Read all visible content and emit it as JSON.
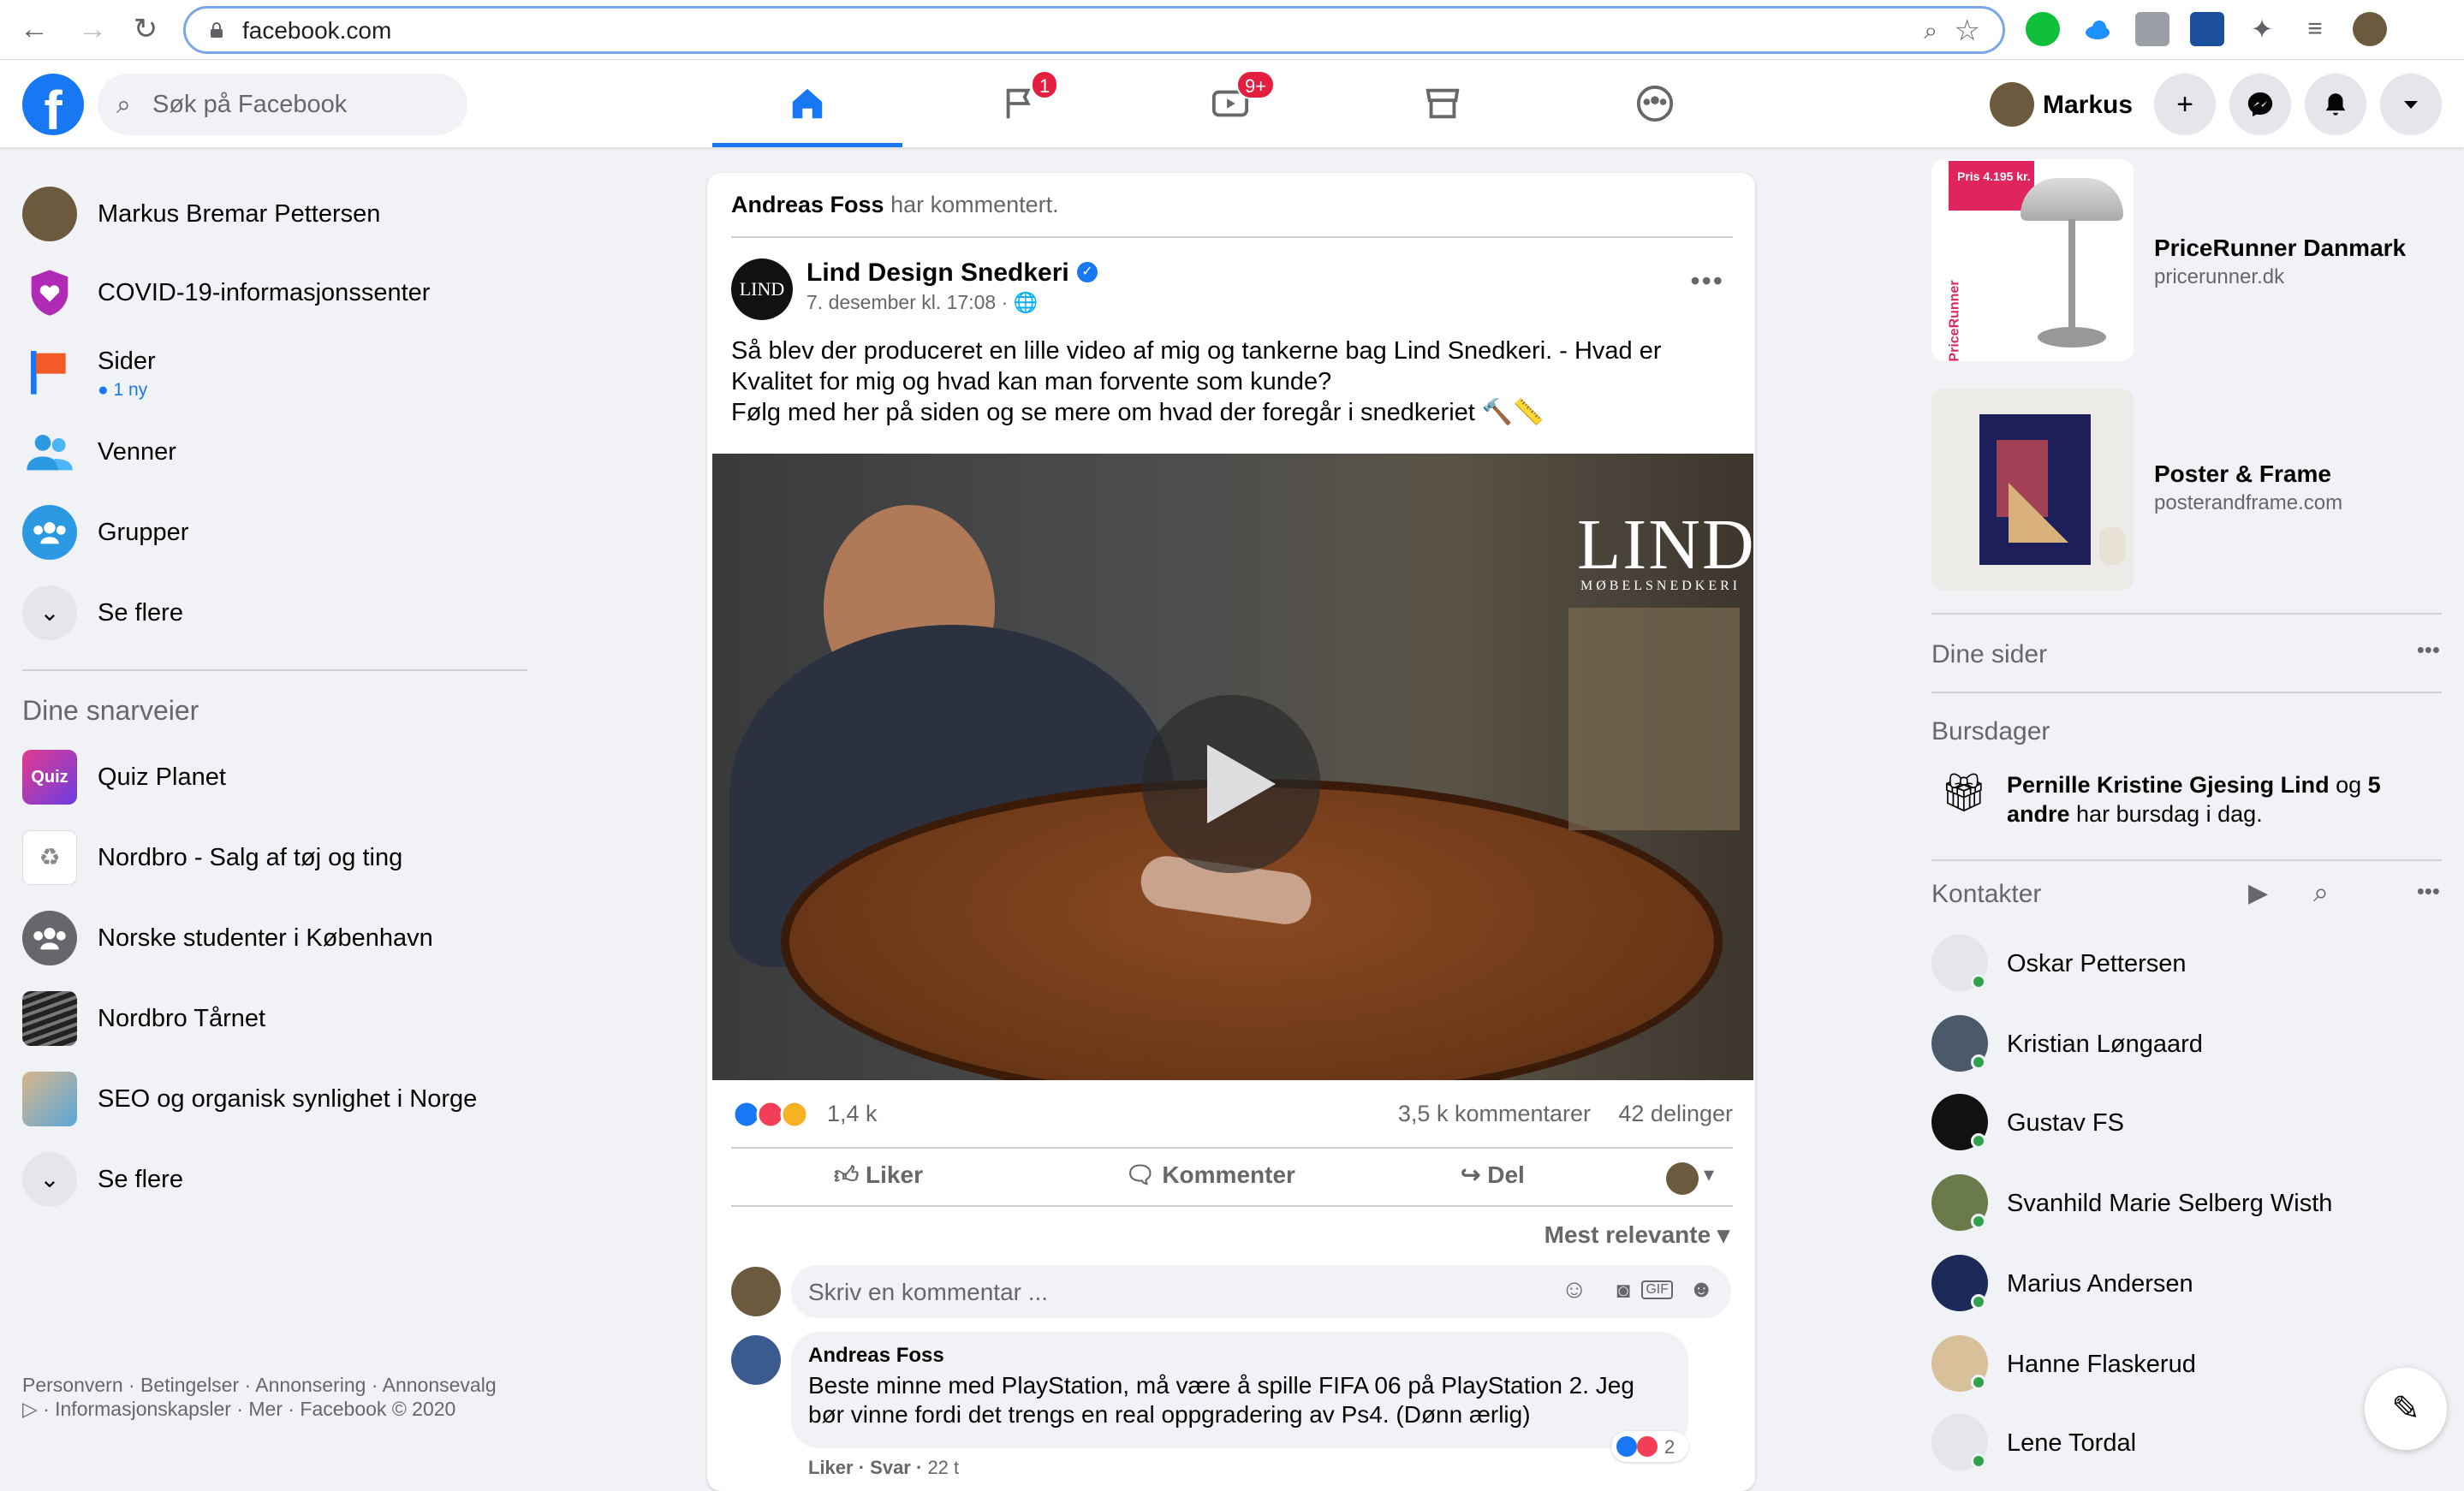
{
  "browser": {
    "url": "facebook.com"
  },
  "header": {
    "search_placeholder": "Søk på Facebook",
    "badges": {
      "watch_pages": "1",
      "watch_video": "9+"
    },
    "profile_name": "Markus"
  },
  "left": {
    "items": [
      {
        "label": "Markus Bremar Pettersen"
      },
      {
        "label": "COVID-19-informasjonssenter"
      },
      {
        "label": "Sider",
        "sub": "● 1 ny"
      },
      {
        "label": "Venner"
      },
      {
        "label": "Grupper"
      },
      {
        "label": "Se flere"
      }
    ],
    "shortcuts_title": "Dine snarveier",
    "shortcuts": [
      {
        "label": "Quiz Planet"
      },
      {
        "label": "Nordbro - Salg af tøj og ting"
      },
      {
        "label": "Norske studenter i København"
      },
      {
        "label": "Nordbro Tårnet"
      },
      {
        "label": "SEO og organisk synlighet i Norge"
      },
      {
        "label": "Se flere"
      }
    ],
    "footer": "Personvern · Betingelser · Annonsering · Annonsevalg ▷ · Informasjonskapsler · Mer · Facebook © 2020"
  },
  "post": {
    "actor": "Andreas Foss",
    "actor_action": "har kommentert.",
    "page_avatar_text": "LIND",
    "page_name": "Lind Design Snedkeri",
    "meta": "7. desember kl. 17:08 · 🌐",
    "text": "Så blev der produceret en lille video af mig og tankerne bag Lind Snedkeri. - Hvad er Kvalitet for mig og hvad kan man forvente som kunde?\nFølg med her på siden og se mere om hvad der foregår i snedkeriet 🔨📏",
    "video_logo": "LIND",
    "video_logo_sub": "MØBELSNEDKERI",
    "reactions_count": "1,4 k",
    "comments_count": "3,5 k kommentarer",
    "shares_count": "42 delinger",
    "actions": {
      "like": "Liker",
      "comment": "Kommenter",
      "share": "Del"
    },
    "sort": "Mest relevante ▾",
    "comment_placeholder": "Skriv en kommentar ...",
    "comment": {
      "author": "Andreas Foss",
      "text": "Beste minne med PlayStation, må være å spille FIFA 06 på PlayStation 2. Jeg bør vinne fordi det trengs en real oppgradering av Ps4. (Dønn ærlig)",
      "reaction_count": "2",
      "like": "Liker",
      "reply": "Svar",
      "time": "22 t"
    }
  },
  "right": {
    "ads": [
      {
        "title": "PriceRunner Danmark",
        "domain": "pricerunner.dk",
        "img_text": "PriceRunner",
        "tag": "Pris 4.195 kr."
      },
      {
        "title": "Poster & Frame",
        "domain": "posterandframe.com"
      }
    ],
    "pages_title": "Dine sider",
    "birthdays_title": "Bursdager",
    "birthday_name": "Pernille Kristine Gjesing Lind",
    "birthday_og": "og",
    "birthday_others": "5 andre",
    "birthday_rest": "har bursdag i dag.",
    "contacts_title": "Kontakter",
    "contacts": [
      {
        "name": "Oskar Pettersen"
      },
      {
        "name": "Kristian Løngaard"
      },
      {
        "name": "Gustav FS"
      },
      {
        "name": "Svanhild Marie Selberg Wisth"
      },
      {
        "name": "Marius Andersen"
      },
      {
        "name": "Hanne Flaskerud"
      },
      {
        "name": "Lene Tordal"
      }
    ]
  },
  "colors": {
    "accent": "#1877f2",
    "badge": "#e41e3f",
    "online": "#31a24c"
  }
}
